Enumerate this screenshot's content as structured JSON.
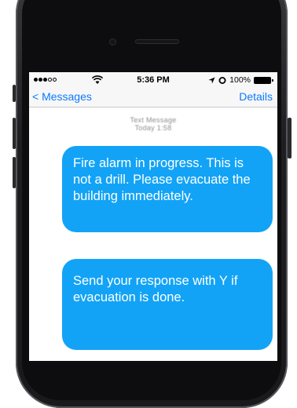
{
  "status_bar": {
    "carrier_signal": "●●●○○",
    "time": "5:36 PM",
    "battery_percent": "100%"
  },
  "nav": {
    "back_label": "< Messages",
    "details_label": "Details"
  },
  "conversation": {
    "meta_line1": "Text Message",
    "meta_line2": "Today 1:58",
    "messages": [
      {
        "text": "Fire alarm in progress. This is not a drill. Please evacuate the building immediately."
      },
      {
        "text": "Send your response with Y if evacuation is done."
      }
    ]
  },
  "colors": {
    "bubble": "#12a3f6",
    "link": "#0a7aff"
  }
}
